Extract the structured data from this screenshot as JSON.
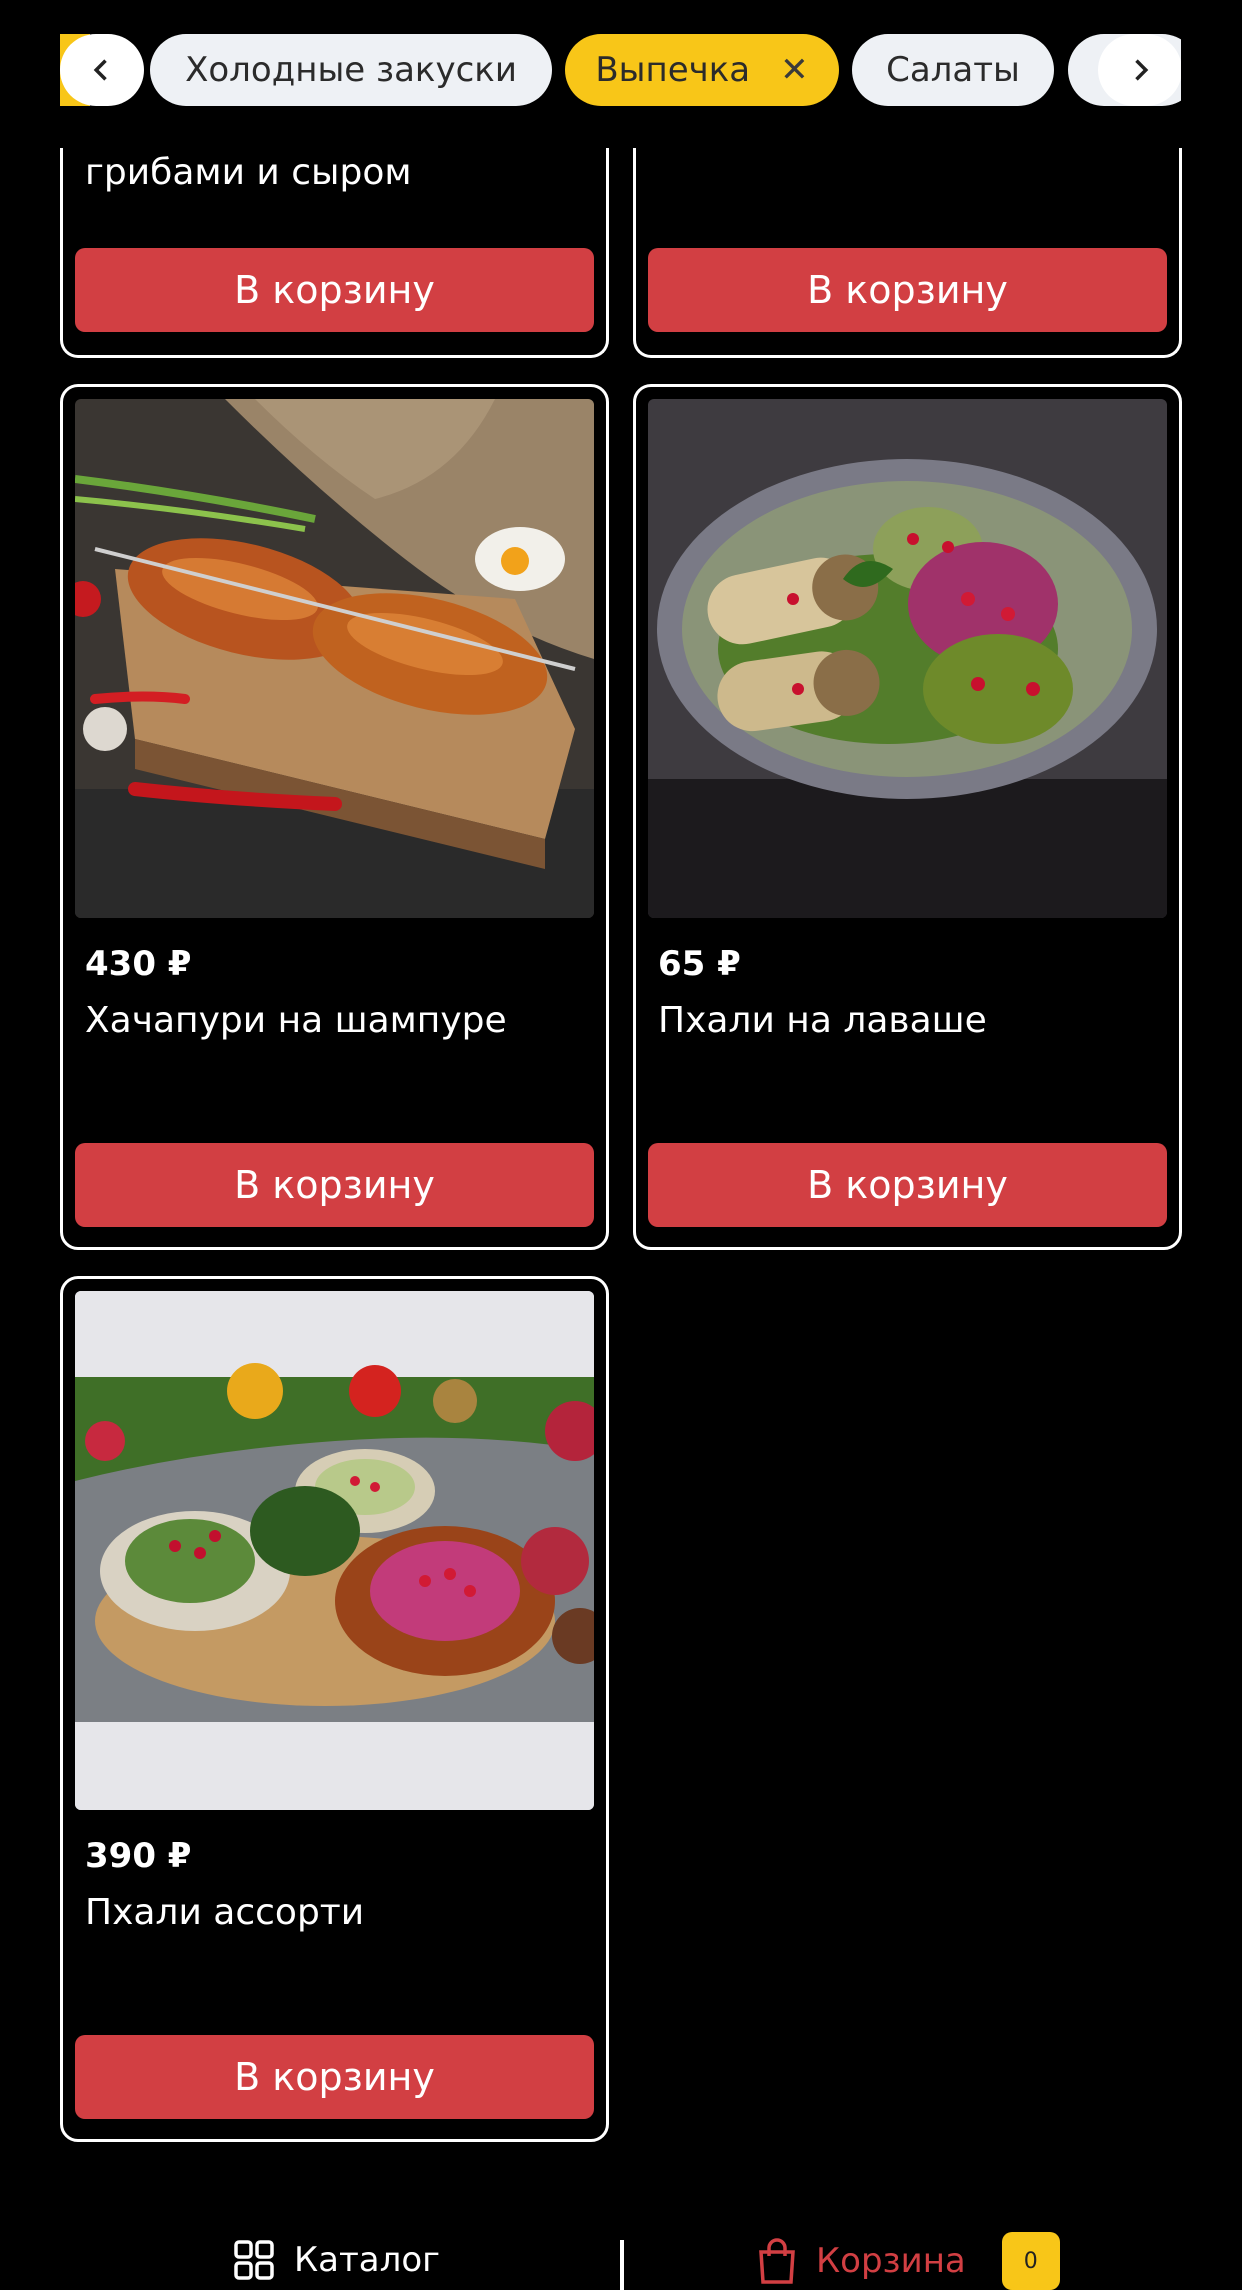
{
  "categories": {
    "items": [
      {
        "label": "Холодные закуски",
        "active": false
      },
      {
        "label": "Выпечка",
        "active": true
      },
      {
        "label": "Салаты",
        "active": false
      }
    ],
    "active_color": "#f8c618"
  },
  "products": [
    {
      "name": "грибами и сыром",
      "button": "В корзину"
    },
    {
      "name": "",
      "button": "В корзину"
    },
    {
      "price": "430 ₽",
      "name": "Хачапури на шампуре",
      "button": "В корзину"
    },
    {
      "price": "65 ₽",
      "name": "Пхали на лаваше",
      "button": "В корзину"
    },
    {
      "price": "390 ₽",
      "name": "Пхали ассорти",
      "button": "В корзину"
    }
  ],
  "bottom_nav": {
    "catalog_label": "Каталог",
    "cart_label": "Корзина",
    "cart_count": "0",
    "cart_color": "#d23f43"
  },
  "colors": {
    "button": "#d23f43",
    "badge": "#f8c618"
  }
}
